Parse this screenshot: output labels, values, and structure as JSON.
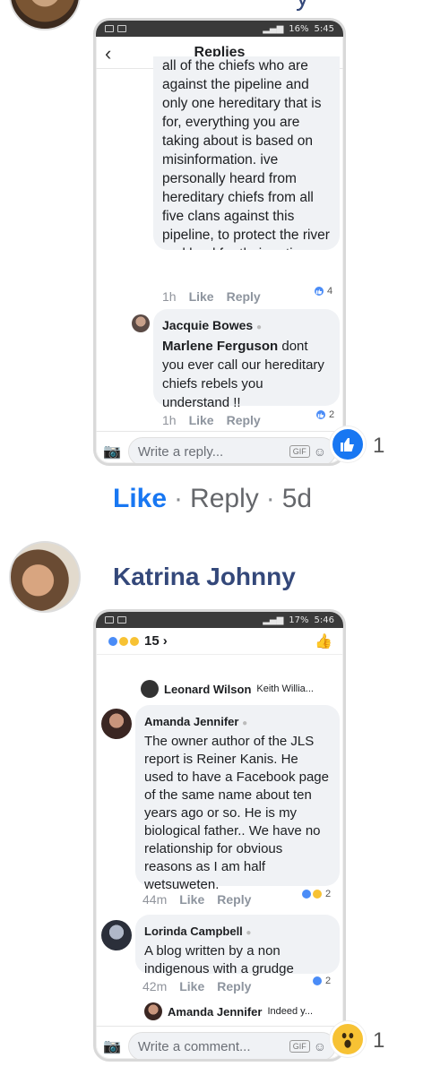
{
  "top_partial": {
    "name_fragment": "y"
  },
  "card1": {
    "status_time": "5:45",
    "status_battery": "16%",
    "header_title": "Replies",
    "comment_text": "all of the chiefs who are against the pipeline and only one hereditary that is for, everything you are taking about is based on misinformation. ive personally heard from hereditary chiefs from all five clans  against this pipeline, to protect the river and land for their nation and descendants",
    "comment_meta": {
      "time": "1h",
      "like": "Like",
      "reply": "Reply",
      "reactions": "4"
    },
    "reply": {
      "author": "Jacquie Bowes",
      "mention": "Marlene Ferguson",
      "text": " dont you ever call our hereditary chiefs rebels you understand !!",
      "time": "1h",
      "like": "Like",
      "reply_label": "Reply",
      "reactions": "2"
    },
    "input_placeholder": "Write a reply...",
    "gif_label": "GIF"
  },
  "card1_reaction": {
    "count": "1"
  },
  "action_row1": {
    "like": "Like",
    "reply": "Reply",
    "dot": "·",
    "age": "5d"
  },
  "commenter2": {
    "name": "Katrina Johnny"
  },
  "card2": {
    "status_time": "5:46",
    "status_battery": "17%",
    "header_count": "15",
    "thread_top": {
      "author": "Leonard Wilson",
      "preview": "Keith Willia..."
    },
    "c1": {
      "author": "Amanda Jennifer",
      "text": "The owner author of the JLS report is Reiner Kanis. He used to have a Facebook page of the same name about ten years ago or so. He is my biological father.. We have no relationship for obvious reasons as I am half wetsuweten.",
      "time": "44m",
      "like": "Like",
      "reply": "Reply",
      "reactions": "2"
    },
    "c2": {
      "author": "Lorinda Campbell",
      "text": "A blog written by a non indigenous with a grudge",
      "time": "42m",
      "like": "Like",
      "reply": "Reply",
      "reactions": "2"
    },
    "c3_preview": {
      "author": "Amanda Jennifer",
      "preview": "Indeed y..."
    },
    "input_placeholder": "Write a comment...",
    "gif_label": "GIF"
  },
  "card2_reaction": {
    "count": "1"
  },
  "colors": {
    "fb_blue": "#1877f2",
    "name_blue": "#34487a",
    "bubble": "#f0f2f5",
    "wow_yellow": "#f7c234"
  }
}
